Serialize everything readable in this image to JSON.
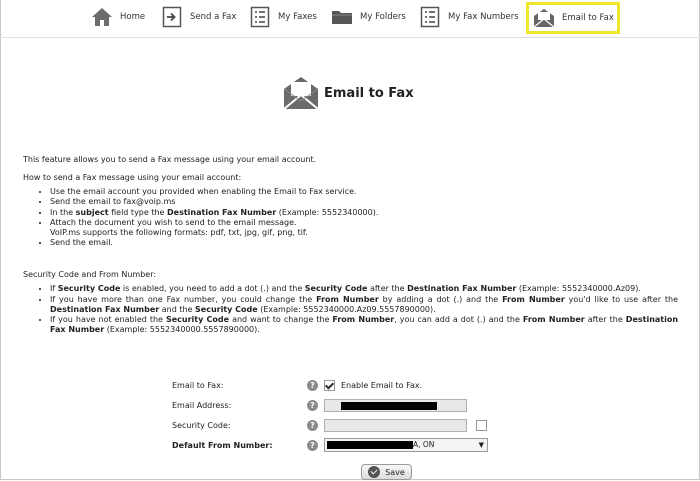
{
  "nav": {
    "items": [
      {
        "label": "Home",
        "icon": "home-icon"
      },
      {
        "label": "Send a Fax",
        "icon": "send-fax-icon"
      },
      {
        "label": "My Faxes",
        "icon": "list-icon"
      },
      {
        "label": "My Folders",
        "icon": "folder-icon"
      },
      {
        "label": "My Fax Numbers",
        "icon": "list-icon"
      },
      {
        "label": "Email to Fax",
        "icon": "envelope-icon",
        "active": true
      }
    ],
    "active_highlight_color": "#f0e62a"
  },
  "header": {
    "title": "Email to Fax",
    "icon": "envelope-icon"
  },
  "content": {
    "intro": "This feature allows you to send a Fax message using your email account.",
    "how_title": "How to send a Fax message using your email account:",
    "steps": {
      "s1": "Use the email account you provided when enabling the Email to Fax service.",
      "s2": "Send the email to fax@voip.ms",
      "s3_a": "In the ",
      "s3_b": "subject",
      "s3_c": " field type the ",
      "s3_d": "Destination Fax Number",
      "s3_e": " (Example: 5552340000).",
      "s4": "Attach the document you wish to send to the email message.",
      "s4_note": "VoIP.ms supports the following formats: pdf, txt, jpg, gif, png, tif.",
      "s5": "Send the email."
    },
    "security_title": "Security Code and From Number:",
    "security": {
      "b1_a": "If ",
      "b1_b": "Security Code",
      "b1_c": " is enabled, you need to add a dot (.) and the ",
      "b1_d": "Security Code",
      "b1_e": " after the ",
      "b1_f": "Destination Fax Number",
      "b1_g": " (Example: 5552340000.Az09).",
      "b2_a": "If you have more than one Fax number, you could change the ",
      "b2_b": "From Number",
      "b2_c": " by adding a dot (.) and the ",
      "b2_d": "From Number",
      "b2_e": " you'd like to use after the ",
      "b2_f": "Destination Fax Number",
      "b2_g": " and the ",
      "b2_h": "Security Code",
      "b2_i": " (Example: 5552340000.Az09.5557890000).",
      "b3_a": "If you have not enabled the ",
      "b3_b": "Security Code",
      "b3_c": " and want to change the ",
      "b3_d": "From Number",
      "b3_e": ", you can add a dot (.) and the ",
      "b3_f": "From Number",
      "b3_g": " after the ",
      "b3_h": "Destination Fax Number",
      "b3_i": " (Example: 5552340000.5557890000)."
    }
  },
  "form": {
    "email_to_fax_label": "Email to Fax:",
    "enable_label": "Enable Email to Fax.",
    "enable_checked": true,
    "email_address_label": "Email Address:",
    "security_code_label": "Security Code:",
    "security_code_checked": false,
    "default_from_label": "Default From Number:",
    "default_from_value_suffix": "A, ON",
    "help_glyph": "?",
    "save_label": "Save"
  }
}
